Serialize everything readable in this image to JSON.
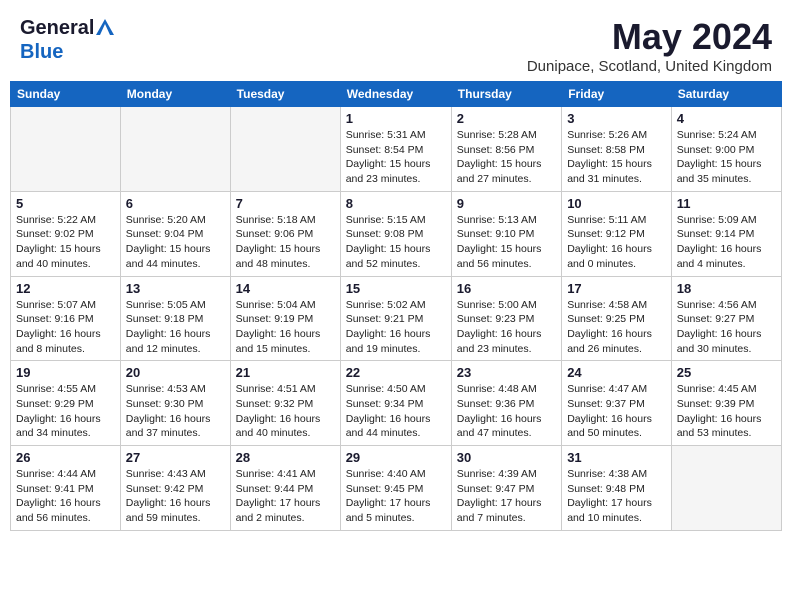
{
  "header": {
    "logo_general": "General",
    "logo_blue": "Blue",
    "title": "May 2024",
    "location": "Dunipace, Scotland, United Kingdom"
  },
  "weekdays": [
    "Sunday",
    "Monday",
    "Tuesday",
    "Wednesday",
    "Thursday",
    "Friday",
    "Saturday"
  ],
  "weeks": [
    [
      {
        "day": "",
        "info": ""
      },
      {
        "day": "",
        "info": ""
      },
      {
        "day": "",
        "info": ""
      },
      {
        "day": "1",
        "info": "Sunrise: 5:31 AM\nSunset: 8:54 PM\nDaylight: 15 hours\nand 23 minutes."
      },
      {
        "day": "2",
        "info": "Sunrise: 5:28 AM\nSunset: 8:56 PM\nDaylight: 15 hours\nand 27 minutes."
      },
      {
        "day": "3",
        "info": "Sunrise: 5:26 AM\nSunset: 8:58 PM\nDaylight: 15 hours\nand 31 minutes."
      },
      {
        "day": "4",
        "info": "Sunrise: 5:24 AM\nSunset: 9:00 PM\nDaylight: 15 hours\nand 35 minutes."
      }
    ],
    [
      {
        "day": "5",
        "info": "Sunrise: 5:22 AM\nSunset: 9:02 PM\nDaylight: 15 hours\nand 40 minutes."
      },
      {
        "day": "6",
        "info": "Sunrise: 5:20 AM\nSunset: 9:04 PM\nDaylight: 15 hours\nand 44 minutes."
      },
      {
        "day": "7",
        "info": "Sunrise: 5:18 AM\nSunset: 9:06 PM\nDaylight: 15 hours\nand 48 minutes."
      },
      {
        "day": "8",
        "info": "Sunrise: 5:15 AM\nSunset: 9:08 PM\nDaylight: 15 hours\nand 52 minutes."
      },
      {
        "day": "9",
        "info": "Sunrise: 5:13 AM\nSunset: 9:10 PM\nDaylight: 15 hours\nand 56 minutes."
      },
      {
        "day": "10",
        "info": "Sunrise: 5:11 AM\nSunset: 9:12 PM\nDaylight: 16 hours\nand 0 minutes."
      },
      {
        "day": "11",
        "info": "Sunrise: 5:09 AM\nSunset: 9:14 PM\nDaylight: 16 hours\nand 4 minutes."
      }
    ],
    [
      {
        "day": "12",
        "info": "Sunrise: 5:07 AM\nSunset: 9:16 PM\nDaylight: 16 hours\nand 8 minutes."
      },
      {
        "day": "13",
        "info": "Sunrise: 5:05 AM\nSunset: 9:18 PM\nDaylight: 16 hours\nand 12 minutes."
      },
      {
        "day": "14",
        "info": "Sunrise: 5:04 AM\nSunset: 9:19 PM\nDaylight: 16 hours\nand 15 minutes."
      },
      {
        "day": "15",
        "info": "Sunrise: 5:02 AM\nSunset: 9:21 PM\nDaylight: 16 hours\nand 19 minutes."
      },
      {
        "day": "16",
        "info": "Sunrise: 5:00 AM\nSunset: 9:23 PM\nDaylight: 16 hours\nand 23 minutes."
      },
      {
        "day": "17",
        "info": "Sunrise: 4:58 AM\nSunset: 9:25 PM\nDaylight: 16 hours\nand 26 minutes."
      },
      {
        "day": "18",
        "info": "Sunrise: 4:56 AM\nSunset: 9:27 PM\nDaylight: 16 hours\nand 30 minutes."
      }
    ],
    [
      {
        "day": "19",
        "info": "Sunrise: 4:55 AM\nSunset: 9:29 PM\nDaylight: 16 hours\nand 34 minutes."
      },
      {
        "day": "20",
        "info": "Sunrise: 4:53 AM\nSunset: 9:30 PM\nDaylight: 16 hours\nand 37 minutes."
      },
      {
        "day": "21",
        "info": "Sunrise: 4:51 AM\nSunset: 9:32 PM\nDaylight: 16 hours\nand 40 minutes."
      },
      {
        "day": "22",
        "info": "Sunrise: 4:50 AM\nSunset: 9:34 PM\nDaylight: 16 hours\nand 44 minutes."
      },
      {
        "day": "23",
        "info": "Sunrise: 4:48 AM\nSunset: 9:36 PM\nDaylight: 16 hours\nand 47 minutes."
      },
      {
        "day": "24",
        "info": "Sunrise: 4:47 AM\nSunset: 9:37 PM\nDaylight: 16 hours\nand 50 minutes."
      },
      {
        "day": "25",
        "info": "Sunrise: 4:45 AM\nSunset: 9:39 PM\nDaylight: 16 hours\nand 53 minutes."
      }
    ],
    [
      {
        "day": "26",
        "info": "Sunrise: 4:44 AM\nSunset: 9:41 PM\nDaylight: 16 hours\nand 56 minutes."
      },
      {
        "day": "27",
        "info": "Sunrise: 4:43 AM\nSunset: 9:42 PM\nDaylight: 16 hours\nand 59 minutes."
      },
      {
        "day": "28",
        "info": "Sunrise: 4:41 AM\nSunset: 9:44 PM\nDaylight: 17 hours\nand 2 minutes."
      },
      {
        "day": "29",
        "info": "Sunrise: 4:40 AM\nSunset: 9:45 PM\nDaylight: 17 hours\nand 5 minutes."
      },
      {
        "day": "30",
        "info": "Sunrise: 4:39 AM\nSunset: 9:47 PM\nDaylight: 17 hours\nand 7 minutes."
      },
      {
        "day": "31",
        "info": "Sunrise: 4:38 AM\nSunset: 9:48 PM\nDaylight: 17 hours\nand 10 minutes."
      },
      {
        "day": "",
        "info": ""
      }
    ]
  ]
}
